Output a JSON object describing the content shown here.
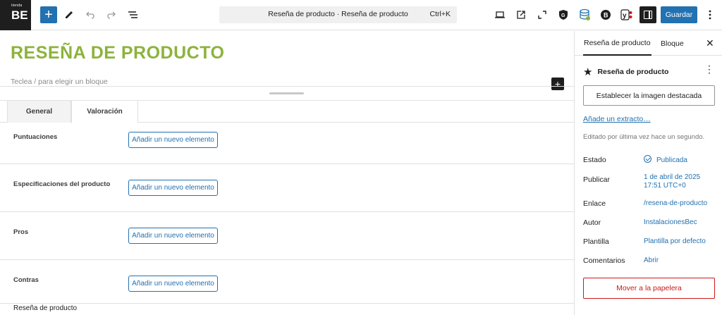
{
  "logo": {
    "small_text": "tienda",
    "big_text": "BE"
  },
  "toolbar": {
    "command_title": "Reseña de producto · Reseña de producto",
    "command_shortcut": "Ctrl+K",
    "save_label": "Guardar",
    "accent_color": "#2271b1"
  },
  "editor": {
    "post_title": "RESEÑA DE PRODUCTO",
    "title_color": "#8cb33b",
    "block_placeholder": "Teclea / para elegir un bloque",
    "tabs": [
      {
        "label": "General"
      },
      {
        "label": "Valoración"
      }
    ],
    "fields": [
      {
        "label": "Puntuaciones",
        "button": "Añadir un nuevo elemento"
      },
      {
        "label": "Especificaciones del producto",
        "button": "Añadir un nuevo elemento"
      },
      {
        "label": "Pros",
        "button": "Añadir un nuevo elemento"
      },
      {
        "label": "Contras",
        "button": "Añadir un nuevo elemento"
      }
    ],
    "bottom_label": "Reseña de producto"
  },
  "sidebar": {
    "tabs": [
      {
        "label": "Reseña de producto"
      },
      {
        "label": "Bloque"
      }
    ],
    "post_type": "Reseña de producto",
    "featured_image_button": "Establecer la imagen destacada",
    "excerpt_link": "Añade un extracto…",
    "last_edited": "Editado por última vez hace un segundo.",
    "properties": {
      "estado": {
        "label": "Estado",
        "value": "Publicada"
      },
      "publicar": {
        "label": "Publicar",
        "value_line1": "1 de abril de 2025",
        "value_line2": "17:51 UTC+0"
      },
      "enlace": {
        "label": "Enlace",
        "value": "/resena-de-producto"
      },
      "autor": {
        "label": "Autor",
        "value": "InstalacionesBec"
      },
      "plantilla": {
        "label": "Plantilla",
        "value": "Plantilla por defecto"
      },
      "comentarios": {
        "label": "Comentarios",
        "value": "Abrir"
      }
    },
    "trash_button": "Mover a la papelera",
    "danger_color": "#cc1818"
  }
}
